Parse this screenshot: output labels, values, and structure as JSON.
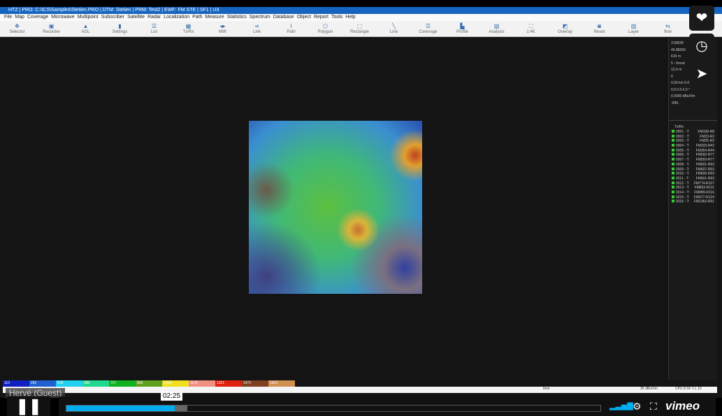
{
  "window": {
    "title": "HTZ | PRO: C:\\ICS\\Samples\\Stetien.PRO | DTM: Stetien | PRM: Test2 | EWF: FM STE | SF1 | U3"
  },
  "menu": [
    "File",
    "Map",
    "Coverage",
    "Microwave",
    "Multipoint",
    "Subscriber",
    "Satellite",
    "Radar",
    "Localization",
    "Path",
    "Measure",
    "Statistics",
    "Spectrum",
    "Database",
    "Object",
    "Report",
    "Tools",
    "Help"
  ],
  "toolbar": [
    {
      "label": "Selector",
      "icon": "✥"
    },
    {
      "label": "Recorder",
      "icon": "▣"
    },
    {
      "label": "AGL",
      "icon": "▲"
    },
    {
      "label": "Settings",
      "icon": "▮"
    },
    {
      "label": "List",
      "icon": "☰"
    },
    {
      "label": "Tx/Rx",
      "icon": "▦"
    },
    {
      "label": "MW",
      "icon": "◂▸"
    },
    {
      "label": "Link",
      "icon": "⋖"
    },
    {
      "label": "Path",
      "icon": "⌇"
    },
    {
      "label": "Polygon",
      "icon": "⬠"
    },
    {
      "label": "Rectangle",
      "icon": "⬚"
    },
    {
      "label": "Line",
      "icon": "╲"
    },
    {
      "label": "Coverage",
      "icon": "☰"
    },
    {
      "label": "Profile",
      "icon": "▙"
    },
    {
      "label": "Analysis",
      "icon": "▨"
    },
    {
      "label": "1:4K",
      "icon": "⛶"
    },
    {
      "label": "Overlay",
      "icon": "◩"
    },
    {
      "label": "Reset",
      "icon": "◙"
    },
    {
      "label": "Layer",
      "icon": "▥"
    },
    {
      "label": "flow",
      "icon": "⇆"
    }
  ],
  "info": [
    "3.58035",
    "45.88260",
    "610 m",
    "5 - forest",
    "12.0 m",
    "0",
    "0.00 km 0.0",
    "0.0 0.0 0.0 °",
    "0.0000 dBuV/m",
    "-999."
  ],
  "txrx": {
    "header": "Tx/Rx",
    "items": [
      [
        "0001 - T:",
        "FM108-R8"
      ],
      [
        "0002 - T:",
        "FM23-R2"
      ],
      [
        "0003 - T:",
        "FM25-R2"
      ],
      [
        "0004 - T:",
        "FM333-R42"
      ],
      [
        "0005 - T:",
        "FM364-R44"
      ],
      [
        "0006 - T:",
        "FM592-R77"
      ],
      [
        "0007 - T:",
        "FM593-R77"
      ],
      [
        "0008 - T:",
        "FM601-R93"
      ],
      [
        "0009 - T:",
        "FM607-R93"
      ],
      [
        "0010 - T:",
        "FM600-R93"
      ],
      [
        "0011 - T:",
        "FM601-R93"
      ],
      [
        "0012 - T:",
        "FM774-R107"
      ],
      [
        "0013 - T:",
        "FM852-R111"
      ],
      [
        "0014 - T:",
        "FM889-R116"
      ],
      [
        "0015 - T:",
        "FM977-R124"
      ],
      [
        "0016 - T:",
        "FM1063-R91"
      ]
    ]
  },
  "legend": [
    {
      "v": "110",
      "c": "#1020c0"
    },
    {
      "v": "262",
      "c": "#2060d0"
    },
    {
      "v": "418",
      "c": "#20d0f0"
    },
    {
      "v": "580",
      "c": "#20d890"
    },
    {
      "v": "727",
      "c": "#10b020"
    },
    {
      "v": "868",
      "c": "#60a020"
    },
    {
      "v": "1019",
      "c": "#f0e020"
    },
    {
      "v": "1170",
      "c": "#f09080"
    },
    {
      "v": "1321",
      "c": "#e02010"
    },
    {
      "v": "1472",
      "c": "#804020"
    },
    {
      "v": "1623",
      "c": "#d09050"
    }
  ],
  "status": {
    "time": "time",
    "field": "35 dBuV/m",
    "cpu": "CPU 8  SF 1  L 10"
  },
  "player": {
    "time": "02:25",
    "progress": 0.203,
    "buffered": 0.227,
    "guest": "Hervé (Guest)",
    "brand": "vimeo"
  }
}
